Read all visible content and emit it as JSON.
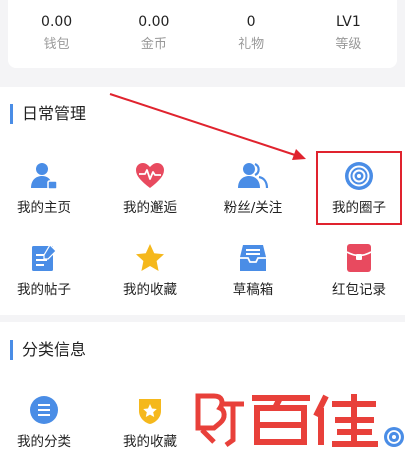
{
  "stats": [
    {
      "value": "0.00",
      "label": "钱包"
    },
    {
      "value": "0.00",
      "label": "金币"
    },
    {
      "value": "0",
      "label": "礼物"
    },
    {
      "value": "LV1",
      "label": "等级"
    }
  ],
  "daily": {
    "title": "日常管理",
    "items": [
      {
        "label": "我的主页",
        "icon": "user-home-icon"
      },
      {
        "label": "我的邂逅",
        "icon": "heart-pulse-icon"
      },
      {
        "label": "粉丝/关注",
        "icon": "users-icon"
      },
      {
        "label": "我的圈子",
        "icon": "circle-target-icon"
      },
      {
        "label": "我的帖子",
        "icon": "edit-note-icon"
      },
      {
        "label": "我的收藏",
        "icon": "star-icon"
      },
      {
        "label": "草稿箱",
        "icon": "inbox-tray-icon"
      },
      {
        "label": "红包记录",
        "icon": "red-envelope-icon"
      }
    ]
  },
  "category": {
    "title": "分类信息",
    "items": [
      {
        "label": "我的分类",
        "icon": "list-icon"
      },
      {
        "label": "我的收藏",
        "icon": "favorite-badge-icon"
      }
    ]
  },
  "watermark_text": "百佳",
  "colors": {
    "accent": "#4a8de6",
    "annotation": "#e0232e",
    "heart": "#e84a5f",
    "star": "#f5b81c"
  }
}
